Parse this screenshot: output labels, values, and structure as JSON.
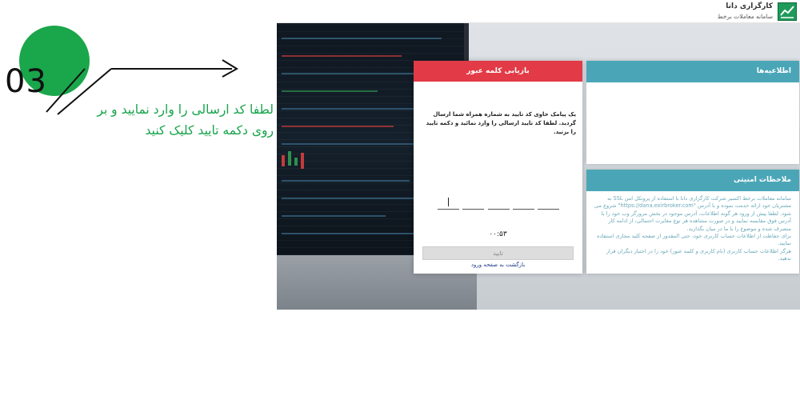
{
  "step": {
    "number": "03",
    "text_line1": "لطفا کد ارسالی را وارد نمایید و بر",
    "text_line2": "روی دکمه تایید کلیک کنید"
  },
  "site": {
    "brand_name": "کارگزاری دانا",
    "brand_subtitle": "سامانه معاملات برخط"
  },
  "recovery": {
    "title": "بازیابی کلمه عبور",
    "message": "یک پیامک حاوی کد تایید به شماره همراه شما ارسال گردید. لطفا کد تایید ارسالی را وارد نمائید و دکمه تایید را بزنید.",
    "code_boxes": [
      "",
      "",
      "",
      "",
      ""
    ],
    "timer": "۰۰:۵۳",
    "confirm_label": "تایید",
    "back_label": "بازگشت به صفحه ورود"
  },
  "news": {
    "title": "اطلاعیه‌ها"
  },
  "security": {
    "title": "ملاحظات امنیتی",
    "paragraphs": [
      "سامانه معاملات برخط اکسیر شرکت کارگزاری دانا با استفاده از پروتکل امن SSL به مشتریان خود ارائه خدمت نموده و با آدرس \"https://dana.exirbroker.com\" شروع می شود. لطفا پیش از ورود هر گونه اطلاعات، آدرس موجود در بخش مرورگر وب خود را با آدرس فوق مقایسه نمایید و در صورت مشاهده هر نوع مغایرت احتمالی، از ادامه کار منصرف شده و موضوع را با ما در میان بگذارید.",
      "برای حفاظت از اطلاعات حساب کاربری خود، حتی المقدور از صفحه کلید مجازی استفاده نمایید.",
      "هرگز اطلاعات حساب کاربری (نام کاربری و کلمه عبور) خود را در اختیار دیگران قرار ندهید."
    ]
  },
  "colors": {
    "accent_green": "#1aa64b",
    "modal_header_red": "#e23a46",
    "panel_header_teal": "#4aa6b7",
    "security_text": "#6aa9b8"
  }
}
